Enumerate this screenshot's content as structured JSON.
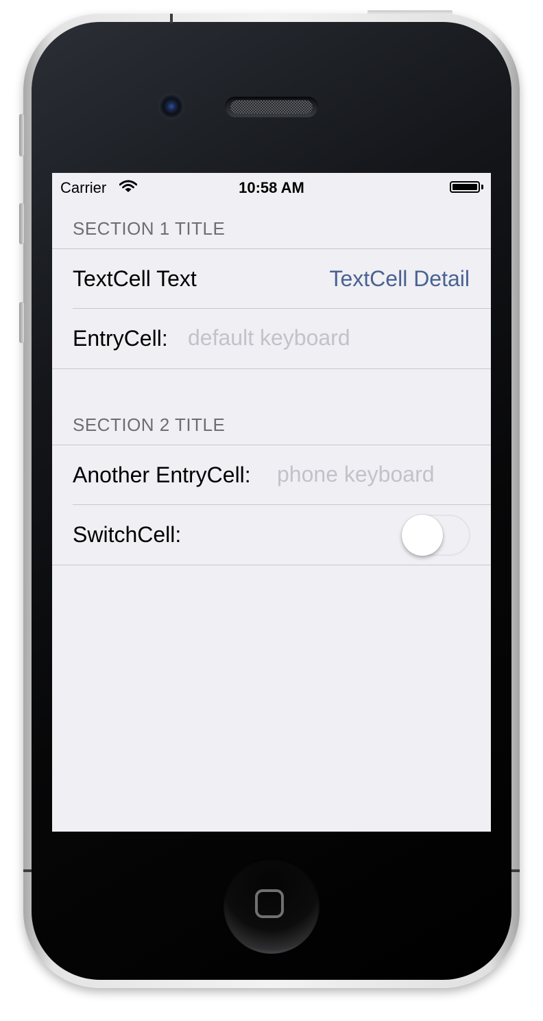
{
  "status_bar": {
    "carrier": "Carrier",
    "time": "10:58 AM"
  },
  "sections": [
    {
      "title": "SECTION 1 TITLE",
      "text_cell": {
        "text": "TextCell Text",
        "detail": "TextCell Detail"
      },
      "entry_cell": {
        "label": "EntryCell:",
        "placeholder": "default keyboard",
        "value": ""
      }
    },
    {
      "title": "SECTION 2 TITLE",
      "entry_cell": {
        "label": "Another EntryCell:",
        "placeholder": "phone keyboard",
        "value": ""
      },
      "switch_cell": {
        "label": "SwitchCell:",
        "on": false
      }
    }
  ],
  "colors": {
    "background": "#efeff4",
    "separator": "#c8c7cc",
    "section_header": "#6d6d72",
    "detail_text": "#4a6290",
    "placeholder": "#c2c2c8"
  },
  "icons": [
    "wifi-icon",
    "battery-icon",
    "home-button-icon"
  ]
}
